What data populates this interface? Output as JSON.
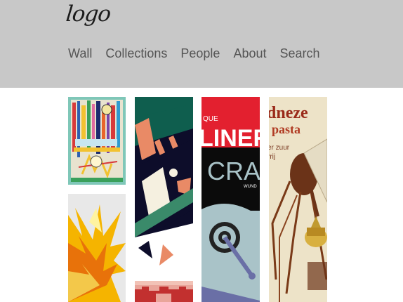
{
  "header": {
    "logo": "logo"
  },
  "nav": {
    "items": [
      {
        "label": "Wall"
      },
      {
        "label": "Collections"
      },
      {
        "label": "People"
      },
      {
        "label": "About"
      },
      {
        "label": "Search"
      }
    ]
  },
  "wall": {
    "tiles": [
      {
        "name": "abstract-colorful-poster"
      },
      {
        "name": "geometric-illustration-poster"
      },
      {
        "name": "liners-crane-poster",
        "text_1": "QUE",
        "text_2": "LINERS",
        "text_3": "CRA",
        "text_4": "WUND"
      },
      {
        "name": "vintage-mosquito-poster",
        "text_1": "dneze",
        "text_2": "pasta",
        "text_3": "er zuur",
        "text_4": "rrij"
      },
      {
        "name": "yellow-burst-poster"
      },
      {
        "name": "pink-pattern-poster"
      }
    ]
  },
  "colors": {
    "header_bg": "#c8c8c8",
    "nav_text": "#555555",
    "page_bg": "#ffffff"
  }
}
